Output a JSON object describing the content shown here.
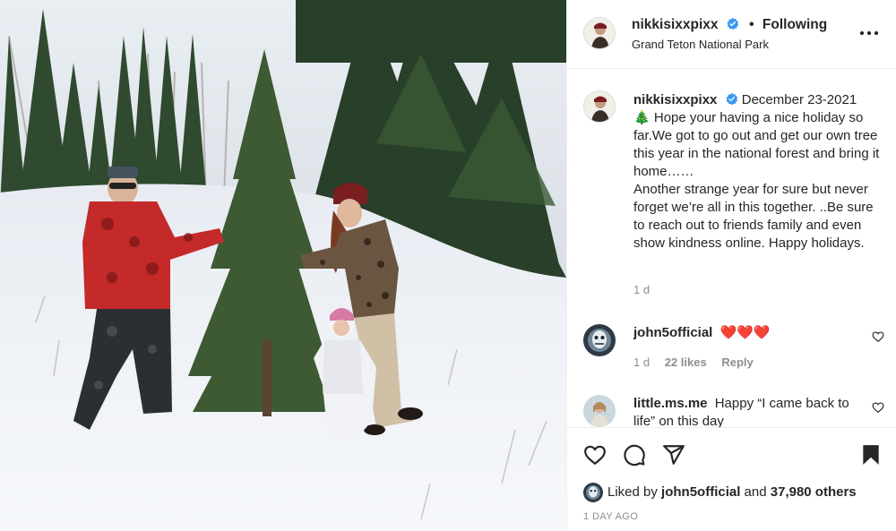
{
  "post": {
    "username": "nikkisixxpixx",
    "follow_separator": "•",
    "follow_status": "Following",
    "location": "Grand Teton National Park",
    "more_options_icon": "more-horizontal-icon"
  },
  "caption": {
    "username": "nikkisixxpixx",
    "date": "December 23-2021",
    "emoji": "🎄",
    "text": " Hope your having a nice holiday so far.We got to go out and get our own tree this year in the national forest and bring it home……\nAnother strange year for sure but never forget we’re all in this together. ..Be sure to reach out to friends family and even show kindness online. Happy holidays.",
    "age": "1 d"
  },
  "comments": [
    {
      "username": "john5official",
      "text": "❤️❤️❤️",
      "age": "1 d",
      "likes": "22 likes",
      "reply": "Reply"
    },
    {
      "username": "little.ms.me",
      "text": "Happy “I came back to life” on this day"
    }
  ],
  "actions": {
    "like_icon": "heart-icon",
    "comment_icon": "comment-icon",
    "share_icon": "share-icon",
    "save_icon": "bookmark-icon"
  },
  "likes": {
    "prefix": "Liked by ",
    "user": "john5official",
    "middle": " and ",
    "count": "37,980 others"
  },
  "timestamp": "1 DAY AGO",
  "colors": {
    "verified": "#3897f0",
    "text": "#262626",
    "muted": "#8e8e8e",
    "heart": "#ed4956"
  }
}
